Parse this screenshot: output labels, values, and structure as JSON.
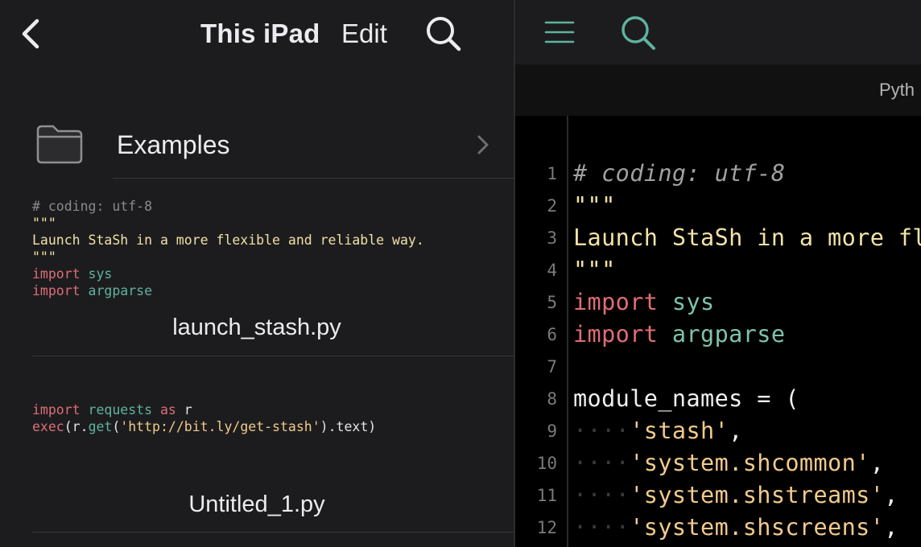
{
  "left": {
    "title": "This iPad",
    "edit_label": "Edit",
    "folder": {
      "name": "Examples"
    },
    "files": [
      {
        "name": "launch_stash.py",
        "preview": [
          [
            [
              "comment",
              "# coding: utf-8"
            ]
          ],
          [
            [
              "string",
              "\"\"\""
            ]
          ],
          [
            [
              "string",
              "Launch StaSh in a more flexible and reliable way."
            ]
          ],
          [
            [
              "string",
              "\"\"\""
            ]
          ],
          [
            [
              "kw",
              "import"
            ],
            [
              "plain",
              " "
            ],
            [
              "id",
              "sys"
            ]
          ],
          [
            [
              "kw",
              "import"
            ],
            [
              "plain",
              " "
            ],
            [
              "id",
              "argparse"
            ]
          ]
        ]
      },
      {
        "name": "Untitled_1.py",
        "preview": [
          [
            [
              "kw",
              "import"
            ],
            [
              "plain",
              " "
            ],
            [
              "id",
              "requests"
            ],
            [
              "plain",
              " "
            ],
            [
              "kw",
              "as"
            ],
            [
              "plain",
              " r"
            ]
          ],
          [
            [
              "kw",
              "exec"
            ],
            [
              "plain",
              "(r."
            ],
            [
              "id",
              "get"
            ],
            [
              "plain",
              "("
            ],
            [
              "str2",
              "'http://bit.ly/get-stash'"
            ],
            [
              "plain",
              ").text)"
            ]
          ]
        ]
      }
    ]
  },
  "editor": {
    "tab_label": "Pyth",
    "lines": [
      {
        "n": "1",
        "tokens": [
          [
            "comment",
            "# coding: utf-8"
          ]
        ]
      },
      {
        "n": "2",
        "tokens": [
          [
            "string",
            "\"\"\""
          ]
        ]
      },
      {
        "n": "3",
        "tokens": [
          [
            "string",
            "Launch StaSh in a more flexible and reliable way."
          ]
        ]
      },
      {
        "n": "4",
        "tokens": [
          [
            "string",
            "\"\"\""
          ]
        ]
      },
      {
        "n": "5",
        "tokens": [
          [
            "kw",
            "import"
          ],
          [
            "plain",
            " "
          ],
          [
            "id",
            "sys"
          ]
        ]
      },
      {
        "n": "6",
        "tokens": [
          [
            "kw",
            "import"
          ],
          [
            "plain",
            " "
          ],
          [
            "id",
            "argparse"
          ]
        ]
      },
      {
        "n": "7",
        "tokens": []
      },
      {
        "n": "8",
        "tokens": [
          [
            "plain",
            "module_names = ("
          ]
        ]
      },
      {
        "n": "9",
        "tokens": [
          [
            "ws",
            "····"
          ],
          [
            "str2",
            "'stash'"
          ],
          [
            "plain",
            ","
          ]
        ]
      },
      {
        "n": "10",
        "tokens": [
          [
            "ws",
            "····"
          ],
          [
            "str2",
            "'system.shcommon'"
          ],
          [
            "plain",
            ","
          ]
        ]
      },
      {
        "n": "11",
        "tokens": [
          [
            "ws",
            "····"
          ],
          [
            "str2",
            "'system.shstreams'"
          ],
          [
            "plain",
            ","
          ]
        ]
      },
      {
        "n": "12",
        "tokens": [
          [
            "ws",
            "····"
          ],
          [
            "str2",
            "'system.shscreens'"
          ],
          [
            "plain",
            ","
          ]
        ]
      }
    ]
  },
  "icons": {
    "back": "chevron-left-icon",
    "search": "search-icon",
    "folder": "folder-icon",
    "disclosure": "chevron-right-icon",
    "menu": "hamburger-menu-icon"
  },
  "colors": {
    "accent": "#5fb3a0",
    "keyword": "#e06c75",
    "string": "#f2e3a7",
    "comment": "#a0a0a0"
  }
}
